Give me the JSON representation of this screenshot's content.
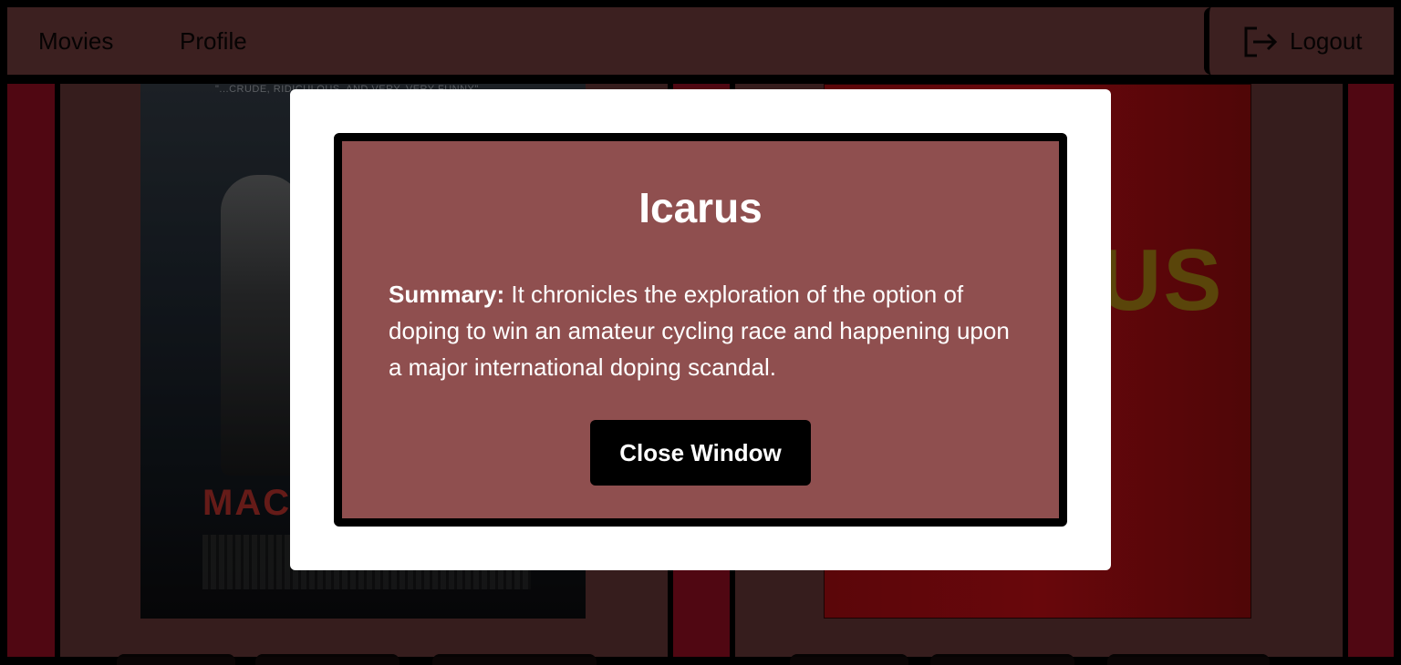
{
  "navbar": {
    "links": [
      "Movies",
      "Profile"
    ],
    "logout_label": "Logout"
  },
  "background": {
    "left_poster": {
      "tagline": "\"...CRUDE, RIDICULOUS, AND VERY, VERY FUNNY\"",
      "title_fragment": "MAC"
    },
    "right_poster": {
      "title_fragment": "US"
    }
  },
  "modal": {
    "title": "Icarus",
    "summary_label": "Summary:",
    "summary_text": " It chronicles the exploration of the option of doping to win an amateur cycling race and happening upon a major international doping scandal.",
    "close_label": "Close Window"
  },
  "colors": {
    "navbar_bg": "#5c3232",
    "side_strip": "#7c0c1d",
    "card_bg": "#532d2d",
    "modal_inner_bg": "#8f4f4f",
    "button_bg": "#000000"
  }
}
